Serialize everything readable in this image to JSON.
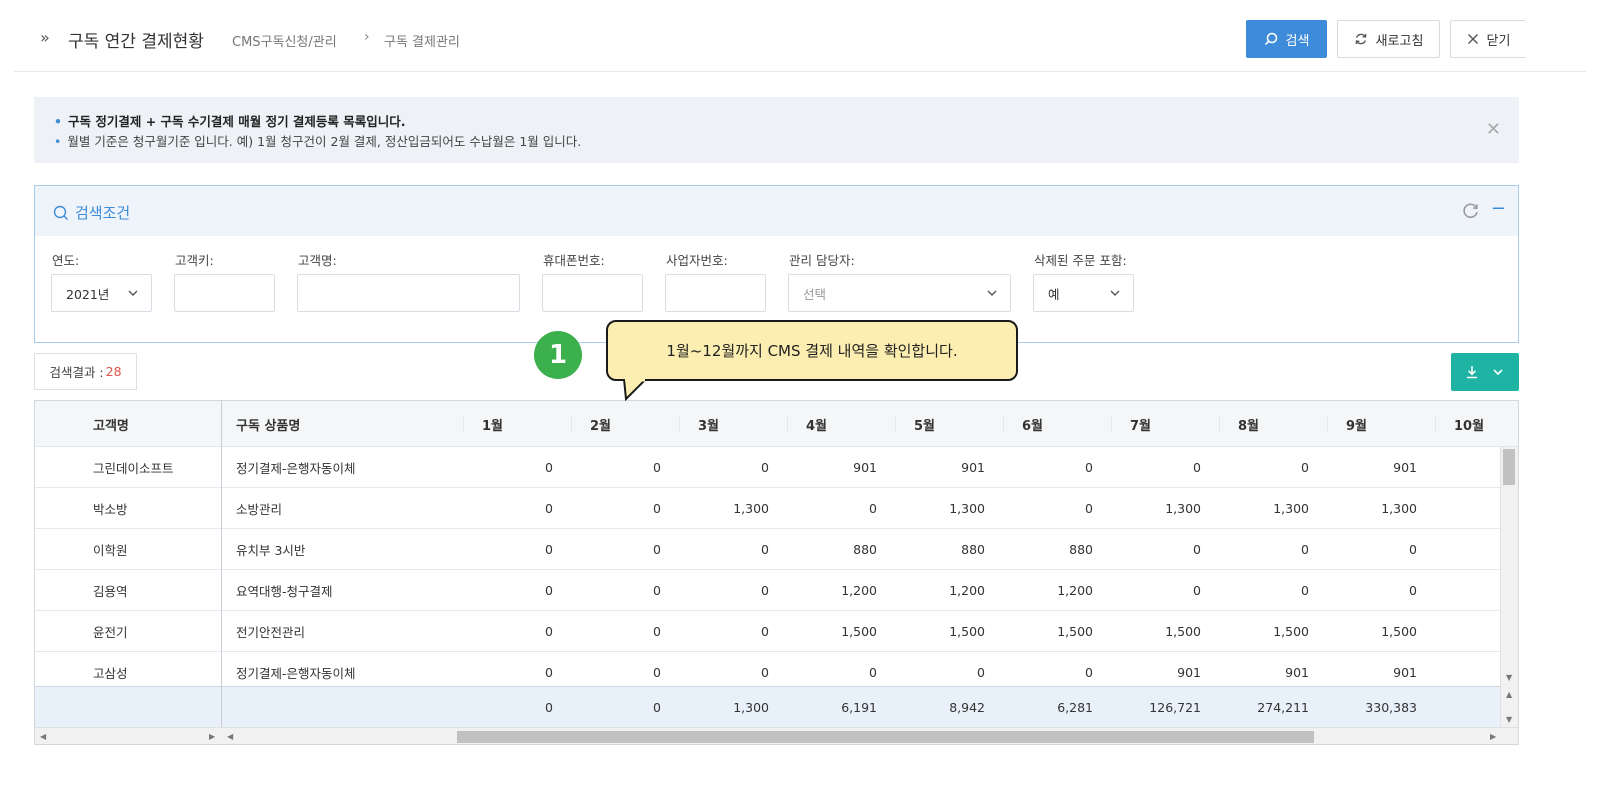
{
  "header": {
    "title": "구독 연간 결제현황",
    "breadcrumb_1": "CMS구독신청/관리",
    "breadcrumb_2": "구독 결제관리",
    "search_label": "검색",
    "refresh_label": "새로고침",
    "close_label": "닫기"
  },
  "notice": {
    "line1": "구독 정기결제 + 구독 수기결제 매월 정기 결제등록 목록입니다.",
    "line2": "월별 기준은 청구월기준 입니다. 예) 1월 청구건이 2월 결제, 정산입금되어도 수납월은 1월 입니다."
  },
  "search_panel": {
    "title": "검색조건",
    "fields": {
      "year_label": "연도:",
      "year_value": "2021년",
      "customer_key_label": "고객키:",
      "customer_name_label": "고객명:",
      "phone_label": "휴대폰번호:",
      "business_no_label": "사업자번호:",
      "manager_label": "관리 담당자:",
      "manager_placeholder": "선택",
      "deleted_label": "삭제된 주문 포함:",
      "deleted_value": "예"
    }
  },
  "result": {
    "label": "검색결과 :",
    "count": "28"
  },
  "callout": {
    "step": "1",
    "text": "1월~12월까지 CMS 결제 내역을 확인합니다."
  },
  "grid": {
    "columns": [
      "고객명",
      "구독 상품명",
      "1월",
      "2월",
      "3월",
      "4월",
      "5월",
      "6월",
      "7월",
      "8월",
      "9월",
      "10월"
    ],
    "rows": [
      {
        "name": "그린데이소프트",
        "product": "정기결제-은행자동이체",
        "m": [
          "0",
          "0",
          "0",
          "901",
          "901",
          "0",
          "0",
          "0",
          "901"
        ]
      },
      {
        "name": "박소방",
        "product": "소방관리",
        "m": [
          "0",
          "0",
          "1,300",
          "0",
          "1,300",
          "0",
          "1,300",
          "1,300",
          "1,300"
        ]
      },
      {
        "name": "이학원",
        "product": "유치부 3시반",
        "m": [
          "0",
          "0",
          "0",
          "880",
          "880",
          "880",
          "0",
          "0",
          "0"
        ]
      },
      {
        "name": "김용역",
        "product": "요역대행-청구결제",
        "m": [
          "0",
          "0",
          "0",
          "1,200",
          "1,200",
          "1,200",
          "0",
          "0",
          "0"
        ]
      },
      {
        "name": "윤전기",
        "product": "전기안전관리",
        "m": [
          "0",
          "0",
          "0",
          "1,500",
          "1,500",
          "1,500",
          "1,500",
          "1,500",
          "1,500"
        ]
      },
      {
        "name": "고삼성",
        "product": "정기결제-은행자동이체",
        "m": [
          "0",
          "0",
          "0",
          "0",
          "0",
          "0",
          "901",
          "901",
          "901"
        ]
      }
    ],
    "totals": [
      "0",
      "0",
      "1,300",
      "6,191",
      "8,942",
      "6,281",
      "126,721",
      "274,211",
      "330,383"
    ]
  },
  "colors": {
    "primary": "#3d8bd9",
    "download": "#1fb3a4",
    "step_badge": "#3bb04c",
    "callout_bg": "#fbeeb0",
    "count_highlight": "#e0554d"
  }
}
